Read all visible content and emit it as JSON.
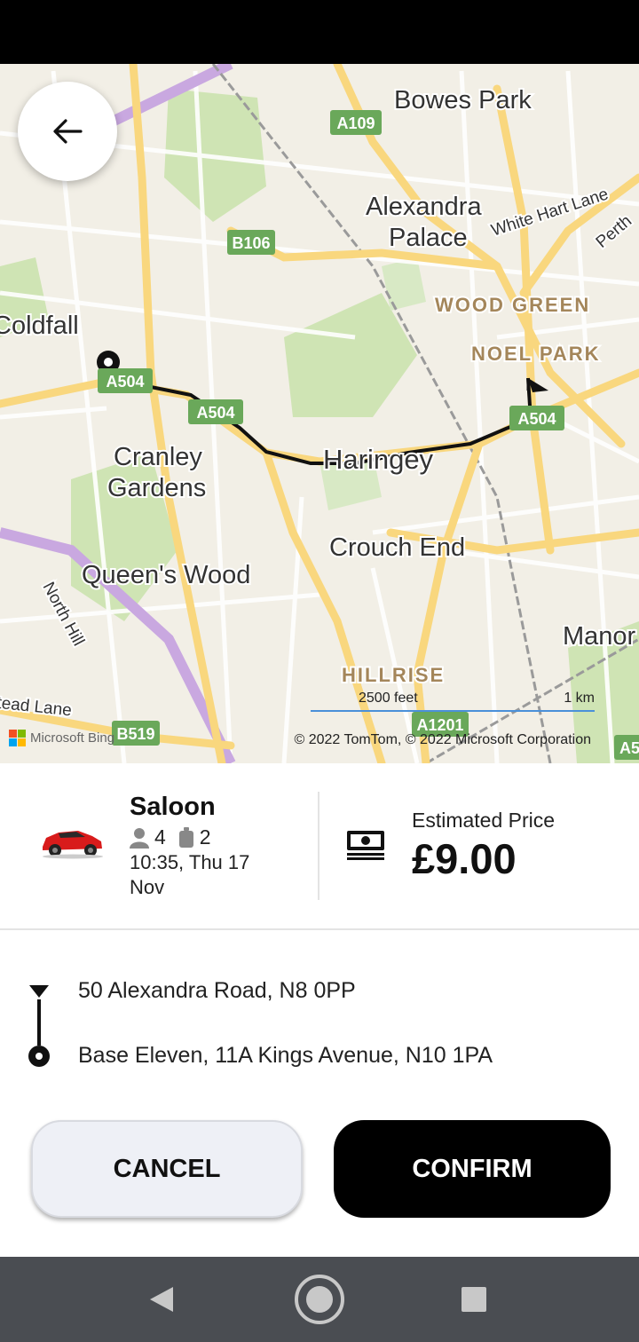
{
  "map": {
    "place_labels": [
      "Bowes Park",
      "Alexandra",
      "Palace",
      "WOOD GREEN",
      "NOEL PARK",
      "Coldfall",
      "Cranley",
      "Gardens",
      "Haringey",
      "Crouch End",
      "Queen's Wood",
      "Manor",
      "HILLRISE",
      "North Hill",
      "White Hart Lane",
      "Perth",
      "tead Lane"
    ],
    "road_badges": [
      "A109",
      "B106",
      "A504",
      "A504",
      "A504",
      "A1201",
      "B519",
      "A5"
    ],
    "scale_left": "2500 feet",
    "scale_right": "1 km",
    "provider": "Microsoft Bing",
    "copyright": "© 2022 TomTom, © 2022 Microsoft Corporation",
    "colors": {
      "road_yellow": "#f9d77e",
      "park_green": "#cfe4b4",
      "route": "#111111"
    }
  },
  "back_button": {
    "icon": "arrow-left-icon"
  },
  "vehicle": {
    "name": "Saloon",
    "passengers": "4",
    "luggage": "2",
    "pickup_time": "10:35, Thu 17 Nov",
    "color": "#d81b1b"
  },
  "price": {
    "label": "Estimated Price",
    "value": "£9.00"
  },
  "route": {
    "destination": "50 Alexandra Road, N8 0PP",
    "pickup": "Base Eleven, 11A Kings Avenue, N10 1PA"
  },
  "actions": {
    "cancel_label": "CANCEL",
    "confirm_label": "CONFIRM"
  },
  "nav": {
    "back": "back-triangle-icon",
    "home": "home-circle-icon",
    "recents": "recents-square-icon"
  }
}
